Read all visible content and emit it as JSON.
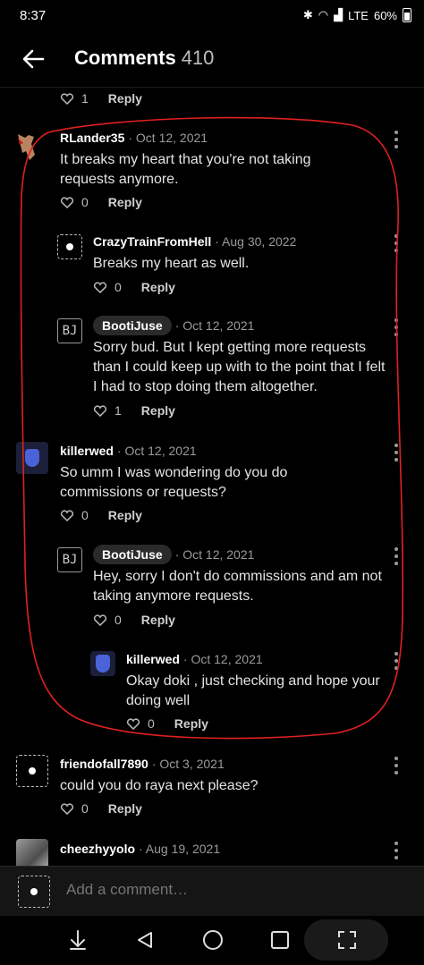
{
  "status_bar": {
    "time": "8:37",
    "network": "LTE",
    "battery": "60%"
  },
  "header": {
    "title": "Comments",
    "count": "410"
  },
  "prev_actions": {
    "likes": "1",
    "reply_label": "Reply"
  },
  "comments": [
    {
      "name": "RLander35",
      "date": "· Oct 12, 2021",
      "text": "It breaks my heart that you're not taking requests anymore.",
      "likes": "0",
      "reply_label": "Reply"
    },
    {
      "name": "CrazyTrainFromHell",
      "date": "· Aug 30, 2022",
      "text": "Breaks my heart as well.",
      "likes": "0",
      "reply_label": "Reply"
    },
    {
      "name": "BootiJuse",
      "date": "· Oct 12, 2021",
      "text": "Sorry bud. But I kept getting more requests than I could keep up with to the point that I felt I had to stop doing them altogether.",
      "likes": "1",
      "reply_label": "Reply"
    },
    {
      "name": "killerwed",
      "date": "· Oct 12, 2021",
      "text": "So umm I was wondering do you do commissions or requests?",
      "likes": "0",
      "reply_label": "Reply"
    },
    {
      "name": "BootiJuse",
      "date": "· Oct 12, 2021",
      "text": "Hey, sorry I don't do commissions and am not taking anymore requests.",
      "likes": "0",
      "reply_label": "Reply"
    },
    {
      "name": "killerwed",
      "date": "· Oct 12, 2021",
      "text": "Okay doki , just checking and hope your doing well",
      "likes": "0",
      "reply_label": "Reply"
    },
    {
      "name": "friendofall7890",
      "date": "· Oct 3, 2021",
      "text": "could you do raya next please?",
      "likes": "0",
      "reply_label": "Reply"
    },
    {
      "name": "cheezhyyolo",
      "date": "· Aug 19, 2021",
      "text": "",
      "likes": "",
      "reply_label": ""
    }
  ],
  "composer": {
    "placeholder": "Add a comment…"
  },
  "colors": {
    "background": "#000000",
    "annotation": "#e02020"
  },
  "icons": [
    "back-arrow-icon",
    "heart-icon",
    "kebab-icon",
    "bluetooth-icon",
    "wifi-icon",
    "signal-icon",
    "battery-icon",
    "nav-down-icon",
    "nav-back-icon",
    "nav-home-icon",
    "nav-recents-icon",
    "nav-expand-icon"
  ]
}
